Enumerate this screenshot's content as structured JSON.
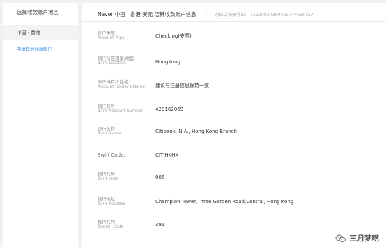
{
  "sidebar": {
    "title": "选择收款账户地区",
    "region_item": "中国 · 香港",
    "apply_link": "申请其他收款账户"
  },
  "header": {
    "title": "Naver 中国 · 香港 美元 店铺收款账户信息",
    "store_id_label": "对应店铺账号ID:",
    "store_id": "11220020369069747656157"
  },
  "rows": [
    {
      "label_cn": "账户类型:",
      "label_en": "Account Type",
      "value": "Checking(支票)"
    },
    {
      "label_cn": "银行所在国家/地区:",
      "label_en": "Bank Location",
      "value": "HongKong"
    },
    {
      "label_cn": "账户持有人姓名:",
      "label_en": "Account Holder's Name",
      "value": "建议与注册信息保持一致"
    },
    {
      "label_cn": "银行账号:",
      "label_en": "Bank Account Number",
      "value": "420162069"
    },
    {
      "label_cn": "银行名称:",
      "label_en": "Bank Name",
      "value": "Citibank, N.A., Hong Kong Branch"
    },
    {
      "label_single": "Swift Code:",
      "value": "CITIHKHX"
    },
    {
      "label_cn": "银行代号:",
      "label_en": "Bank code",
      "value": "006"
    },
    {
      "label_cn": "银行地址:",
      "label_en": "Bank Address",
      "value": "Champion Tower,Three Garden Road,Central, Hong Kong"
    },
    {
      "label_cn": "支行代码:",
      "label_en": "Branch Code",
      "value": "391"
    }
  ],
  "watermark": {
    "text": "三月梦呓",
    "icon": "wechat-icon"
  }
}
